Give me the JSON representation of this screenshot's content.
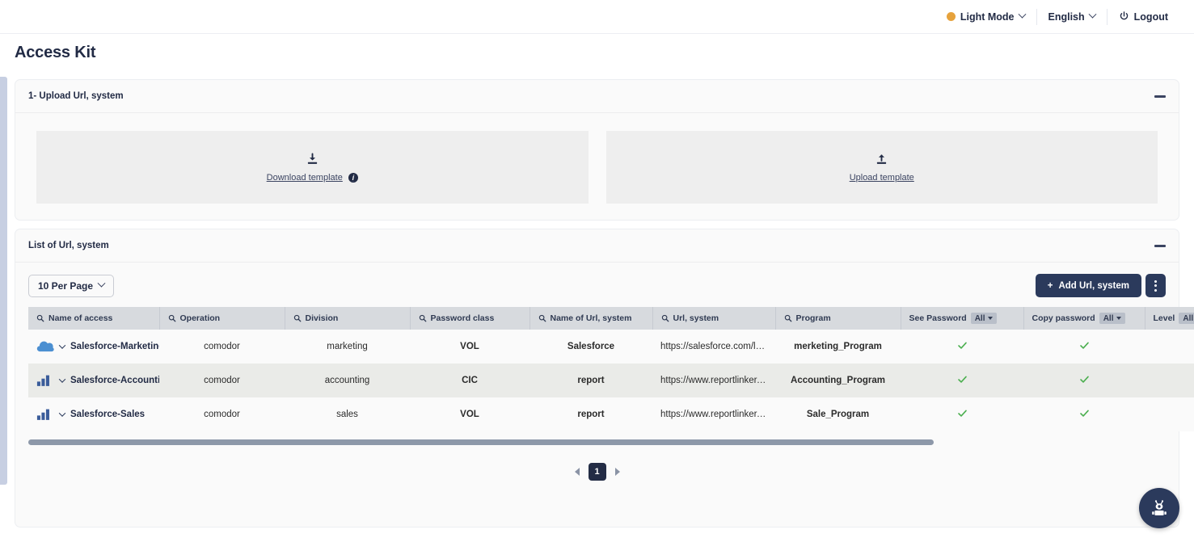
{
  "topbar": {
    "theme_label": "Light Mode",
    "theme_dot_color": "#e6a23c",
    "language_label": "English",
    "logout_label": "Logout"
  },
  "page": {
    "title": "Access Kit"
  },
  "upload_card": {
    "title": "1- Upload Url, system",
    "collapse_label": "−",
    "download": {
      "icon": "download-icon",
      "label": "Download template",
      "info_badge": "i"
    },
    "upload": {
      "icon": "upload-icon",
      "label": "Upload template"
    }
  },
  "list_card": {
    "title": "List of Url, system",
    "collapse_label": "−",
    "toolbar": {
      "per_page_label": "10 Per Page",
      "add_label": "Add Url, system",
      "add_plus": "+",
      "kebab_label": "more-options"
    },
    "columns": [
      {
        "label": "Name of access",
        "search": true,
        "filter": null
      },
      {
        "label": "Operation",
        "search": true,
        "filter": null
      },
      {
        "label": "Division",
        "search": true,
        "filter": null
      },
      {
        "label": "Password class",
        "search": true,
        "filter": null
      },
      {
        "label": "Name of Url, system",
        "search": true,
        "filter": null
      },
      {
        "label": "Url, system",
        "search": true,
        "filter": null
      },
      {
        "label": "Program",
        "search": true,
        "filter": null
      },
      {
        "label": "See Password",
        "search": false,
        "filter": "All"
      },
      {
        "label": "Copy password",
        "search": false,
        "filter": "All"
      },
      {
        "label": "Level",
        "search": false,
        "filter": "All"
      }
    ],
    "rows": [
      {
        "icon": "cloud-icon",
        "name": "Salesforce-Marketing",
        "operation": "comodor",
        "division": "marketing",
        "password_class": "VOL",
        "url_name": "Salesforce",
        "url": "https://salesforce.com/login",
        "program": "merketing_Program",
        "see_password": true,
        "copy_password": true
      },
      {
        "icon": "bar-chart-icon",
        "name": "Salesforce-Accounting.",
        "operation": "comodor",
        "division": "accounting",
        "password_class": "CIC",
        "url_name": "report",
        "url": "https://www.reportlinker.co...",
        "program": "Accounting_Program",
        "see_password": true,
        "copy_password": true
      },
      {
        "icon": "bar-chart-icon",
        "name": "Salesforce-Sales",
        "operation": "comodor",
        "division": "sales",
        "password_class": "VOL",
        "url_name": "report",
        "url": "https://www.reportlinker.co...",
        "program": "Sale_Program",
        "see_password": true,
        "copy_password": true
      }
    ],
    "pagination": {
      "prev": "prev",
      "next": "next",
      "current_page": "1"
    }
  },
  "fab": {
    "label": "robot-assistant"
  },
  "colors": {
    "primary": "#2b3a5c",
    "accent_orange": "#e6a23c",
    "check_green": "#4caf50",
    "header_grey": "#d7dade"
  }
}
